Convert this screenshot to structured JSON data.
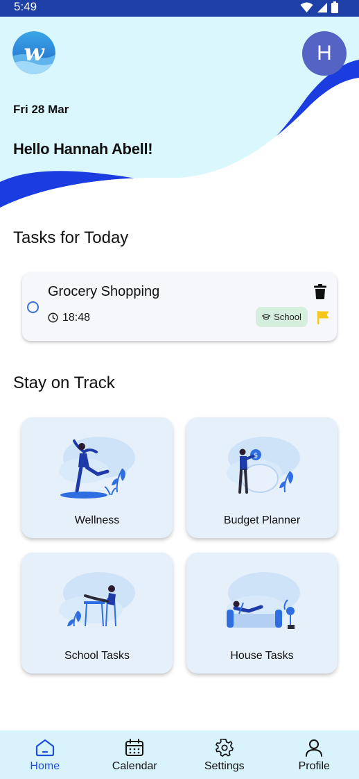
{
  "status_bar": {
    "time": "5:49"
  },
  "header": {
    "avatar_initial": "H",
    "date": "Fri 28 Mar",
    "greeting": "Hello Hannah Abell!"
  },
  "tasks_section": {
    "title": "Tasks for Today",
    "tasks": [
      {
        "title": "Grocery Shopping",
        "time": "18:48",
        "category": "School",
        "completed": false
      }
    ]
  },
  "track_section": {
    "title": "Stay on Track",
    "cards": [
      {
        "label": "Wellness",
        "icon": "wellness-illustration"
      },
      {
        "label": "Budget Planner",
        "icon": "budget-illustration"
      },
      {
        "label": "School Tasks",
        "icon": "school-illustration"
      },
      {
        "label": "House Tasks",
        "icon": "house-illustration"
      }
    ]
  },
  "bottom_nav": {
    "items": [
      {
        "label": "Home",
        "icon": "home-icon",
        "active": true
      },
      {
        "label": "Calendar",
        "icon": "calendar-icon",
        "active": false
      },
      {
        "label": "Settings",
        "icon": "gear-icon",
        "active": false
      },
      {
        "label": "Profile",
        "icon": "user-icon",
        "active": false
      }
    ]
  },
  "colors": {
    "status_bar": "#1e40a6",
    "hero_background": "#d9f7fd",
    "wave": "#1b3de0",
    "accent": "#1f4fd6",
    "avatar": "#5563c4",
    "card_background": "#e6f0fb",
    "badge_background": "#d5eedd",
    "flag": "#f5c518"
  }
}
